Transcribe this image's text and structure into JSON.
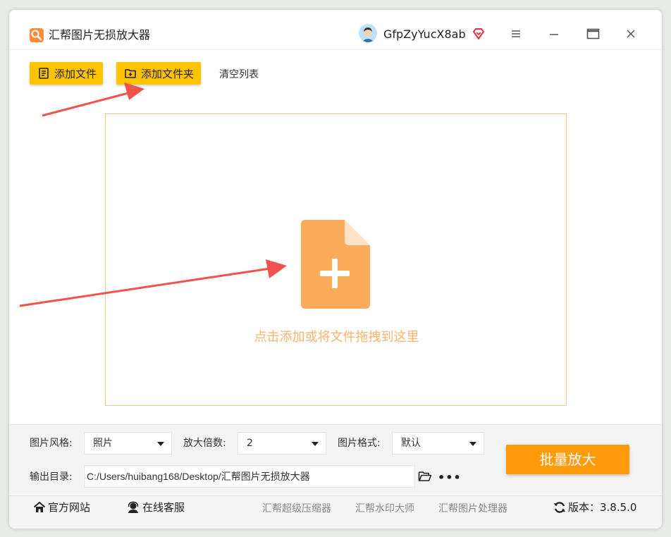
{
  "window": {
    "app_title": "汇帮图片无损放大器",
    "username": "GfpZyYucX8ab"
  },
  "toolbar": {
    "add_file_label": "添加文件",
    "add_folder_label": "添加文件夹",
    "clear_list_label": "清空列表"
  },
  "dropzone": {
    "hint": "点击添加或将文件拖拽到这里"
  },
  "settings": {
    "style_label": "图片风格:",
    "style_value": "照片",
    "scale_label": "放大倍数:",
    "scale_value": "2",
    "format_label": "图片格式:",
    "format_value": "默认",
    "output_label": "输出目录:",
    "output_path": "C:/Users/huibang168/Desktop/汇帮图片无损放大器",
    "more_label": "•••",
    "batch_button": "批量放大"
  },
  "footer": {
    "website": "官方网站",
    "support": "在线客服",
    "app1": "汇帮超级压缩器",
    "app2": "汇帮水印大师",
    "app3": "汇帮图片处理器",
    "version": "版本：3.8.5.0"
  },
  "colors": {
    "accent": "#ffc300",
    "primary_button": "#ff9a0b",
    "dropzone_border": "#fbc57d",
    "file_icon": "#fbac5b",
    "annotation_arrow": "#f0524f"
  },
  "icons": [
    "app-logo-icon",
    "avatar-icon",
    "vip-diamond-icon",
    "menu-icon",
    "minimize-icon",
    "maximize-icon",
    "close-icon",
    "add-file-icon",
    "add-folder-icon",
    "file-plus-icon",
    "caret-down-icon",
    "folder-open-icon",
    "home-icon",
    "headset-icon",
    "refresh-icon"
  ]
}
